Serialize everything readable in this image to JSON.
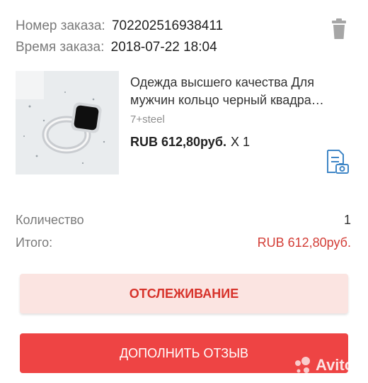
{
  "order": {
    "number_label": "Номер заказа:",
    "number": "702202516938411",
    "time_label": "Время заказа:",
    "time": "2018-07-22 18:04"
  },
  "product": {
    "title_line1": "Одежда высшего качества Для",
    "title_line2": "мужчин кольцо черный квадра…",
    "variant": "7+steel",
    "price": "RUB 612,80руб.",
    "quantity_text": "X 1"
  },
  "summary": {
    "quantity_label": "Количество",
    "quantity_value": "1",
    "total_label": "Итого:",
    "total_value": "RUB 612,80руб."
  },
  "buttons": {
    "track_label": "ОТСЛЕЖИВАНИЕ",
    "review_label": "ДОПОЛНИТЬ ОТЗЫВ"
  },
  "watermark": {
    "text": "Avito"
  },
  "icons": {
    "trash": "trash-icon",
    "receipt": "receipt-camera-icon",
    "product_image": "ring-product-image"
  },
  "colors": {
    "accent_red": "#ee4444",
    "total_red": "#d33d36",
    "track_bg": "#fbe4e1",
    "icon_blue": "#3f86c6"
  }
}
